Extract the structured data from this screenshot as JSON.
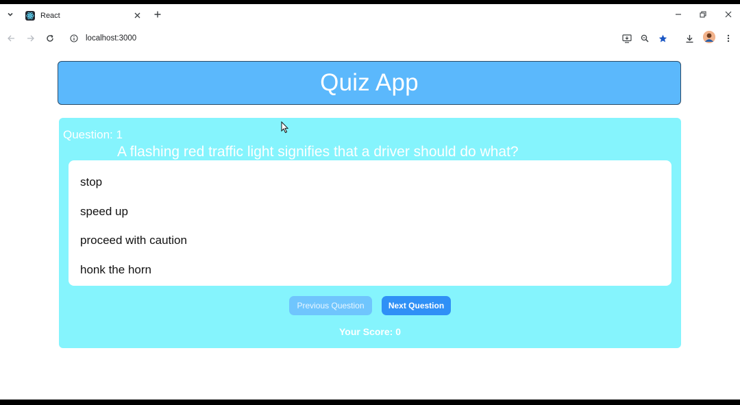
{
  "browser": {
    "tab_title": "React",
    "url": "localhost:3000"
  },
  "app": {
    "title": "Quiz App",
    "question_label": "Question: 1",
    "question_text": "A flashing red traffic light signifies that a driver should do what?",
    "answers": [
      "stop",
      "speed up",
      "proceed with caution",
      "honk the horn"
    ],
    "prev_label": "Previous Question",
    "next_label": "Next Question",
    "score_label": "Your Score: 0"
  },
  "colors": {
    "header_bg": "#5bb8fc",
    "card_bg": "#85f4fd",
    "next_btn": "#2f90f6",
    "prev_btn": "#6fc5fd"
  }
}
